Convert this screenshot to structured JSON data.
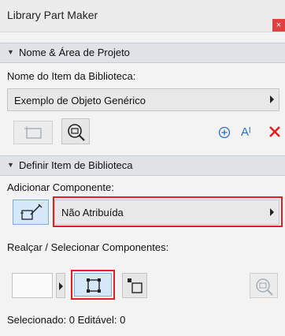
{
  "window": {
    "title": "Library Part Maker",
    "close_glyph": "×"
  },
  "section1": {
    "title": "Nome & Área de Projeto",
    "item_name_label": "Nome do Item da Biblioteca:",
    "item_name_value": "Exemplo de Objeto Genérico"
  },
  "toolbar1": {
    "icons": [
      "project-area-icon",
      "preview-icon",
      "add-icon",
      "text-style-icon",
      "delete-icon"
    ],
    "text_style_glyph": "Aᴵ"
  },
  "section2": {
    "title": "Definir Item de Biblioteca",
    "add_component_label": "Adicionar Componente:",
    "component_value": "Não Atribuída",
    "highlight_label": "Realçar / Selecionar Componentes:"
  },
  "status": {
    "text": "Selecionado: 0 Editável: 0"
  },
  "colors": {
    "accent_red": "#e02020",
    "accent_blue": "#2a6fc9",
    "active_bg": "#d6e9fb"
  }
}
